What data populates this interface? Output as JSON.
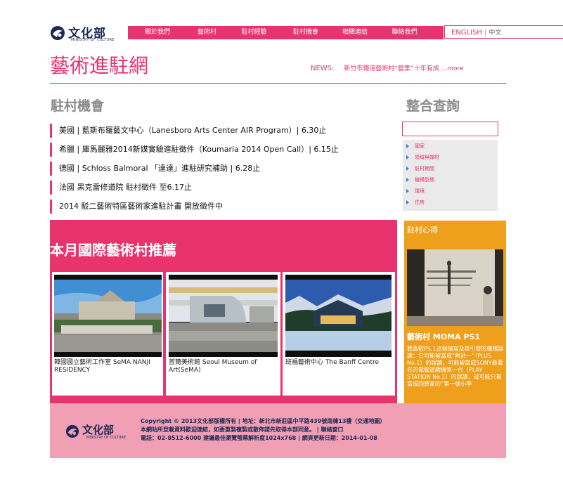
{
  "logo": {
    "name": "文化部",
    "sub": "MINISTRY OF CULTURE"
  },
  "nav": {
    "items": [
      {
        "label": "關於我們"
      },
      {
        "label": "藝術村"
      },
      {
        "label": "駐村經驗"
      },
      {
        "label": "駐村機會"
      },
      {
        "label": "相關連結"
      },
      {
        "label": "聯絡我們"
      }
    ]
  },
  "lang": {
    "english": "ENGLISH",
    "sep": "|",
    "chinese": "中文"
  },
  "site_title": "藝術進駐網",
  "news": {
    "label": "NEWS:",
    "text": "新竹市鐵道藝術村“藝集”十年有成 ...more"
  },
  "opportunities": {
    "heading": "駐村機會",
    "items": [
      "美國 | 藍斯布羅藝文中心（Lanesboro Arts Center AIR Program）| 6.30止",
      "希臘 | 庫馬麗雅2014新媒實驗進駐徵件（Koumaria 2014 Open Call）| 6.15止",
      "德國 | Schloss Balmoral 「達達」進駐研究補助 | 6.28止",
      "法國 黑克雷修道院 駐村徵件 至6.17止",
      "2014 駁二藝術特區藝術家進駐計畫 開放徵件中"
    ]
  },
  "search": {
    "heading": "整合查詢",
    "input_value": "",
    "filters": [
      "國家",
      "領域與媒材",
      "駐村期間",
      "機構型態",
      "環境",
      "住房"
    ]
  },
  "recommend": {
    "heading": "本月國際藝術村推薦",
    "cards": [
      {
        "caption": "韓國國立藝術工作室 SeMA NANJI RESIDENCY"
      },
      {
        "caption": "首爾美術館 Seoul Museum of Art(SeMA)"
      },
      {
        "caption": "班福藝術中心 The Banff Centre"
      }
    ]
  },
  "experience": {
    "heading": "駐村心得",
    "title": "藝術村 MOMA PS1",
    "text": "我喜歡PS.1這個縮寫及其引發的種種誤讀：它可能被當成“附註一”（PLUS No.1）的誤讀，可能被當成SONY最著名的電腦遊戲機第一代（PLAY STATION No.1）的誤讀，或可能只被當成回原家的”第一號小學"
  },
  "footer": {
    "logo_name": "文化部",
    "logo_sub": "MINISTRY OF CULTURE",
    "line1": "Copyright © 2013文化部版權所有 | 地址：新北市新莊區中平路439號南棟13樓（交通地圖）",
    "line2": "本網站所登載資料歡迎連結，如要重製複製或散佈請先取得本部同意。 | 聯絡窗口",
    "line3": "電話：02-8512-6000 建議最佳瀏覽螢幕解析度1024x768 | 網頁更新日期：2014-01-08"
  },
  "colors": {
    "accent": "#e8336f",
    "orange": "#ee9f1c",
    "footer_bg": "#f09fb4",
    "navy": "#1a2a55"
  }
}
